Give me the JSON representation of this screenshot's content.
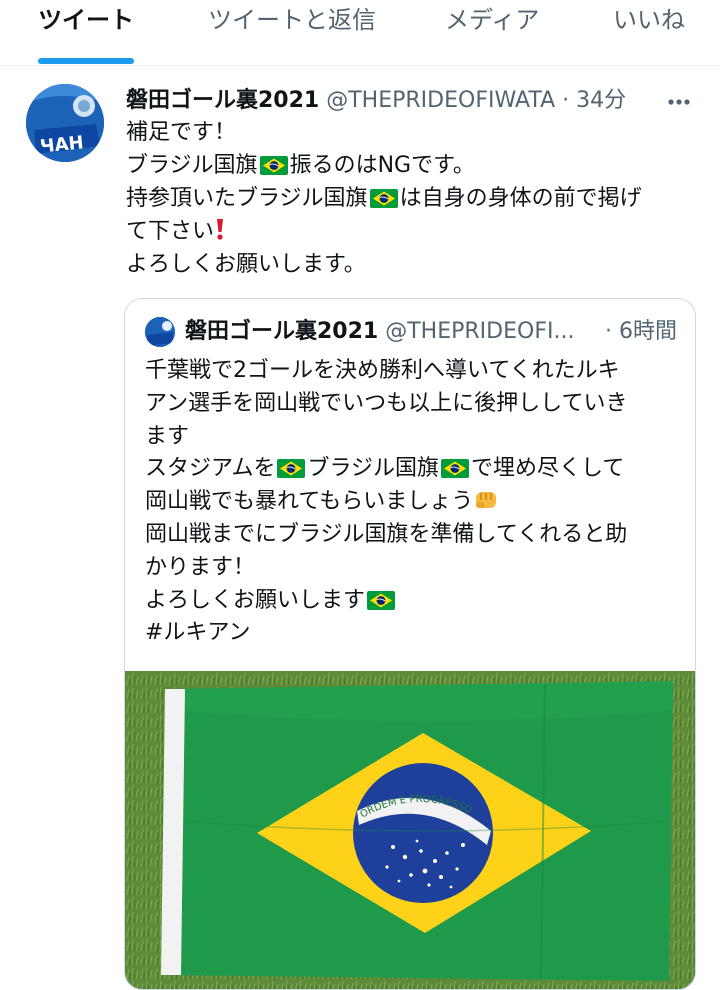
{
  "tabs": [
    {
      "label": "ツイート",
      "active": true
    },
    {
      "label": "ツイートと返信",
      "active": false
    },
    {
      "label": "メディア",
      "active": false
    },
    {
      "label": "いいね",
      "active": false
    }
  ],
  "tweet": {
    "author_name": "磐田ゴール裏2021",
    "handle": "@THEPRIDEOFIWATA",
    "separator": "·",
    "time": "34分",
    "lines": [
      {
        "segments": [
          "補足です！"
        ]
      },
      {
        "segments": [
          "ブラジル国旗",
          "振るのはNGです。"
        ]
      },
      {
        "segments": [
          "持参頂いたブラジル国旗",
          "は自身の身体の前で掲げ"
        ]
      },
      {
        "segments": [
          "て下さい"
        ]
      },
      {
        "segments": [
          "よろしくお願いします。"
        ]
      }
    ]
  },
  "quote": {
    "author_name": "磐田ゴール裏2021",
    "handle": "@THEPRIDEOFI...",
    "time": "· 6時間",
    "lines": [
      {
        "segments": [
          "千葉戦で2ゴールを決め勝利へ導いてくれたルキ"
        ]
      },
      {
        "segments": [
          "アン選手を岡山戦でいつも以上に後押ししていき"
        ]
      },
      {
        "segments": [
          "ます"
        ]
      },
      {
        "segments": [
          "スタジアムを",
          "ブラジル国旗",
          "で埋め尽くして"
        ]
      },
      {
        "segments": [
          "岡山戦でも暴れてもらいましょう"
        ]
      },
      {
        "segments": [
          "岡山戦までにブラジル国旗を準備してくれると助"
        ]
      },
      {
        "segments": [
          "かります！"
        ]
      },
      {
        "segments": [
          "よろしくお願いします"
        ]
      },
      {
        "segments": [
          "#ルキアン"
        ]
      }
    ],
    "photo": {
      "motto": "ORDEM E PROGRESSO"
    }
  },
  "icons": {
    "more": "more-horizontal-icon",
    "flag": "brazil-flag-emoji",
    "exclamation": "red-exclamation-emoji",
    "fist": "oncoming-fist-emoji"
  },
  "colors": {
    "accent": "#1d9bf0",
    "text": "#0f1419",
    "secondary": "#536471",
    "flag_green": "#009c3b",
    "flag_yellow": "#ffdf00",
    "flag_blue": "#002776"
  }
}
